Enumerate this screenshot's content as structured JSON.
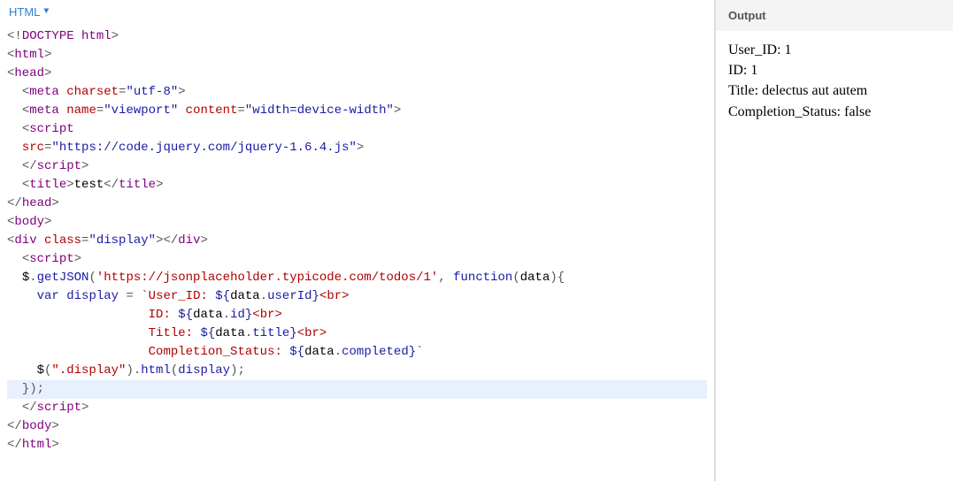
{
  "editor": {
    "tab_label": "HTML",
    "code_tokens": [
      [
        [
          "punct",
          "<!"
        ],
        [
          "tag",
          "DOCTYPE html"
        ],
        [
          "punct",
          ">"
        ]
      ],
      [
        [
          "punct",
          "<"
        ],
        [
          "tag",
          "html"
        ],
        [
          "punct",
          ">"
        ]
      ],
      [
        [
          "punct",
          "<"
        ],
        [
          "tag",
          "head"
        ],
        [
          "punct",
          ">"
        ]
      ],
      [
        [
          "text",
          "  "
        ],
        [
          "punct",
          "<"
        ],
        [
          "tag",
          "meta "
        ],
        [
          "attr",
          "charset"
        ],
        [
          "punct",
          "="
        ],
        [
          "str",
          "\"utf-8\""
        ],
        [
          "punct",
          ">"
        ]
      ],
      [
        [
          "text",
          "  "
        ],
        [
          "punct",
          "<"
        ],
        [
          "tag",
          "meta "
        ],
        [
          "attr",
          "name"
        ],
        [
          "punct",
          "="
        ],
        [
          "str",
          "\"viewport\""
        ],
        [
          "tag",
          " "
        ],
        [
          "attr",
          "content"
        ],
        [
          "punct",
          "="
        ],
        [
          "str",
          "\"width=device-width\""
        ],
        [
          "punct",
          ">"
        ]
      ],
      [
        [
          "text",
          "  "
        ],
        [
          "punct",
          "<"
        ],
        [
          "tag",
          "script"
        ]
      ],
      [
        [
          "text",
          "  "
        ],
        [
          "attr",
          "src"
        ],
        [
          "punct",
          "="
        ],
        [
          "str",
          "\"https://code.jquery.com/jquery-1.6.4.js\""
        ],
        [
          "punct",
          ">"
        ]
      ],
      [
        [
          "text",
          "  "
        ],
        [
          "punct",
          "</"
        ],
        [
          "tag",
          "script"
        ],
        [
          "punct",
          ">"
        ]
      ],
      [
        [
          "text",
          "  "
        ],
        [
          "punct",
          "<"
        ],
        [
          "tag",
          "title"
        ],
        [
          "punct",
          ">"
        ],
        [
          "text",
          "test"
        ],
        [
          "punct",
          "</"
        ],
        [
          "tag",
          "title"
        ],
        [
          "punct",
          ">"
        ]
      ],
      [
        [
          "punct",
          "</"
        ],
        [
          "tag",
          "head"
        ],
        [
          "punct",
          ">"
        ]
      ],
      [
        [
          "punct",
          "<"
        ],
        [
          "tag",
          "body"
        ],
        [
          "punct",
          ">"
        ]
      ],
      [
        [
          "punct",
          "<"
        ],
        [
          "tag",
          "div "
        ],
        [
          "attr",
          "class"
        ],
        [
          "punct",
          "="
        ],
        [
          "str",
          "\"display\""
        ],
        [
          "punct",
          "></"
        ],
        [
          "tag",
          "div"
        ],
        [
          "punct",
          ">"
        ]
      ],
      [
        [
          "text",
          "  "
        ],
        [
          "punct",
          "<"
        ],
        [
          "tag",
          "script"
        ],
        [
          "punct",
          ">"
        ]
      ],
      [
        [
          "text",
          "  "
        ],
        [
          "ident",
          "$"
        ],
        [
          "punct",
          "."
        ],
        [
          "prop",
          "getJSON"
        ],
        [
          "punct",
          "("
        ],
        [
          "jsstr",
          "'https://jsonplaceholder.typicode.com/todos/1'"
        ],
        [
          "punct",
          ", "
        ],
        [
          "kw",
          "function"
        ],
        [
          "punct",
          "("
        ],
        [
          "ident",
          "data"
        ],
        [
          "punct",
          "){"
        ]
      ],
      [
        [
          "text",
          "    "
        ],
        [
          "kw",
          "var"
        ],
        [
          "text",
          " "
        ],
        [
          "var",
          "display"
        ],
        [
          "text",
          " "
        ],
        [
          "punct",
          "= "
        ],
        [
          "templ",
          "`User_ID: "
        ],
        [
          "interp",
          "${"
        ],
        [
          "ident",
          "data"
        ],
        [
          "punct",
          "."
        ],
        [
          "prop",
          "userId"
        ],
        [
          "interp",
          "}"
        ],
        [
          "templ",
          "<br>"
        ]
      ],
      [
        [
          "text",
          "                   "
        ],
        [
          "templ",
          "ID: "
        ],
        [
          "interp",
          "${"
        ],
        [
          "ident",
          "data"
        ],
        [
          "punct",
          "."
        ],
        [
          "prop",
          "id"
        ],
        [
          "interp",
          "}"
        ],
        [
          "templ",
          "<br>"
        ]
      ],
      [
        [
          "text",
          "                   "
        ],
        [
          "templ",
          "Title: "
        ],
        [
          "interp",
          "${"
        ],
        [
          "ident",
          "data"
        ],
        [
          "punct",
          "."
        ],
        [
          "prop",
          "title"
        ],
        [
          "interp",
          "}"
        ],
        [
          "templ",
          "<br>"
        ]
      ],
      [
        [
          "text",
          "                   "
        ],
        [
          "templ",
          "Completion_Status: "
        ],
        [
          "interp",
          "${"
        ],
        [
          "ident",
          "data"
        ],
        [
          "punct",
          "."
        ],
        [
          "prop",
          "completed"
        ],
        [
          "interp",
          "}"
        ],
        [
          "templ",
          "`"
        ]
      ],
      [
        [
          "text",
          "    "
        ],
        [
          "ident",
          "$"
        ],
        [
          "punct",
          "("
        ],
        [
          "jsstr",
          "\".display\""
        ],
        [
          "punct",
          ")."
        ],
        [
          "prop",
          "html"
        ],
        [
          "punct",
          "("
        ],
        [
          "var",
          "display"
        ],
        [
          "punct",
          ");"
        ]
      ],
      [
        [
          "text",
          "  "
        ],
        [
          "punct",
          "});"
        ]
      ],
      [
        [
          "text",
          "  "
        ],
        [
          "punct",
          "</"
        ],
        [
          "tag",
          "script"
        ],
        [
          "punct",
          ">"
        ]
      ],
      [
        [
          "punct",
          "</"
        ],
        [
          "tag",
          "body"
        ],
        [
          "punct",
          ">"
        ]
      ],
      [
        [
          "punct",
          "</"
        ],
        [
          "tag",
          "html"
        ],
        [
          "punct",
          ">"
        ]
      ]
    ],
    "highlight_line_index": 19
  },
  "output": {
    "header": "Output",
    "lines": [
      "User_ID: 1",
      "ID: 1",
      "Title: delectus aut autem",
      "Completion_Status: false"
    ]
  }
}
